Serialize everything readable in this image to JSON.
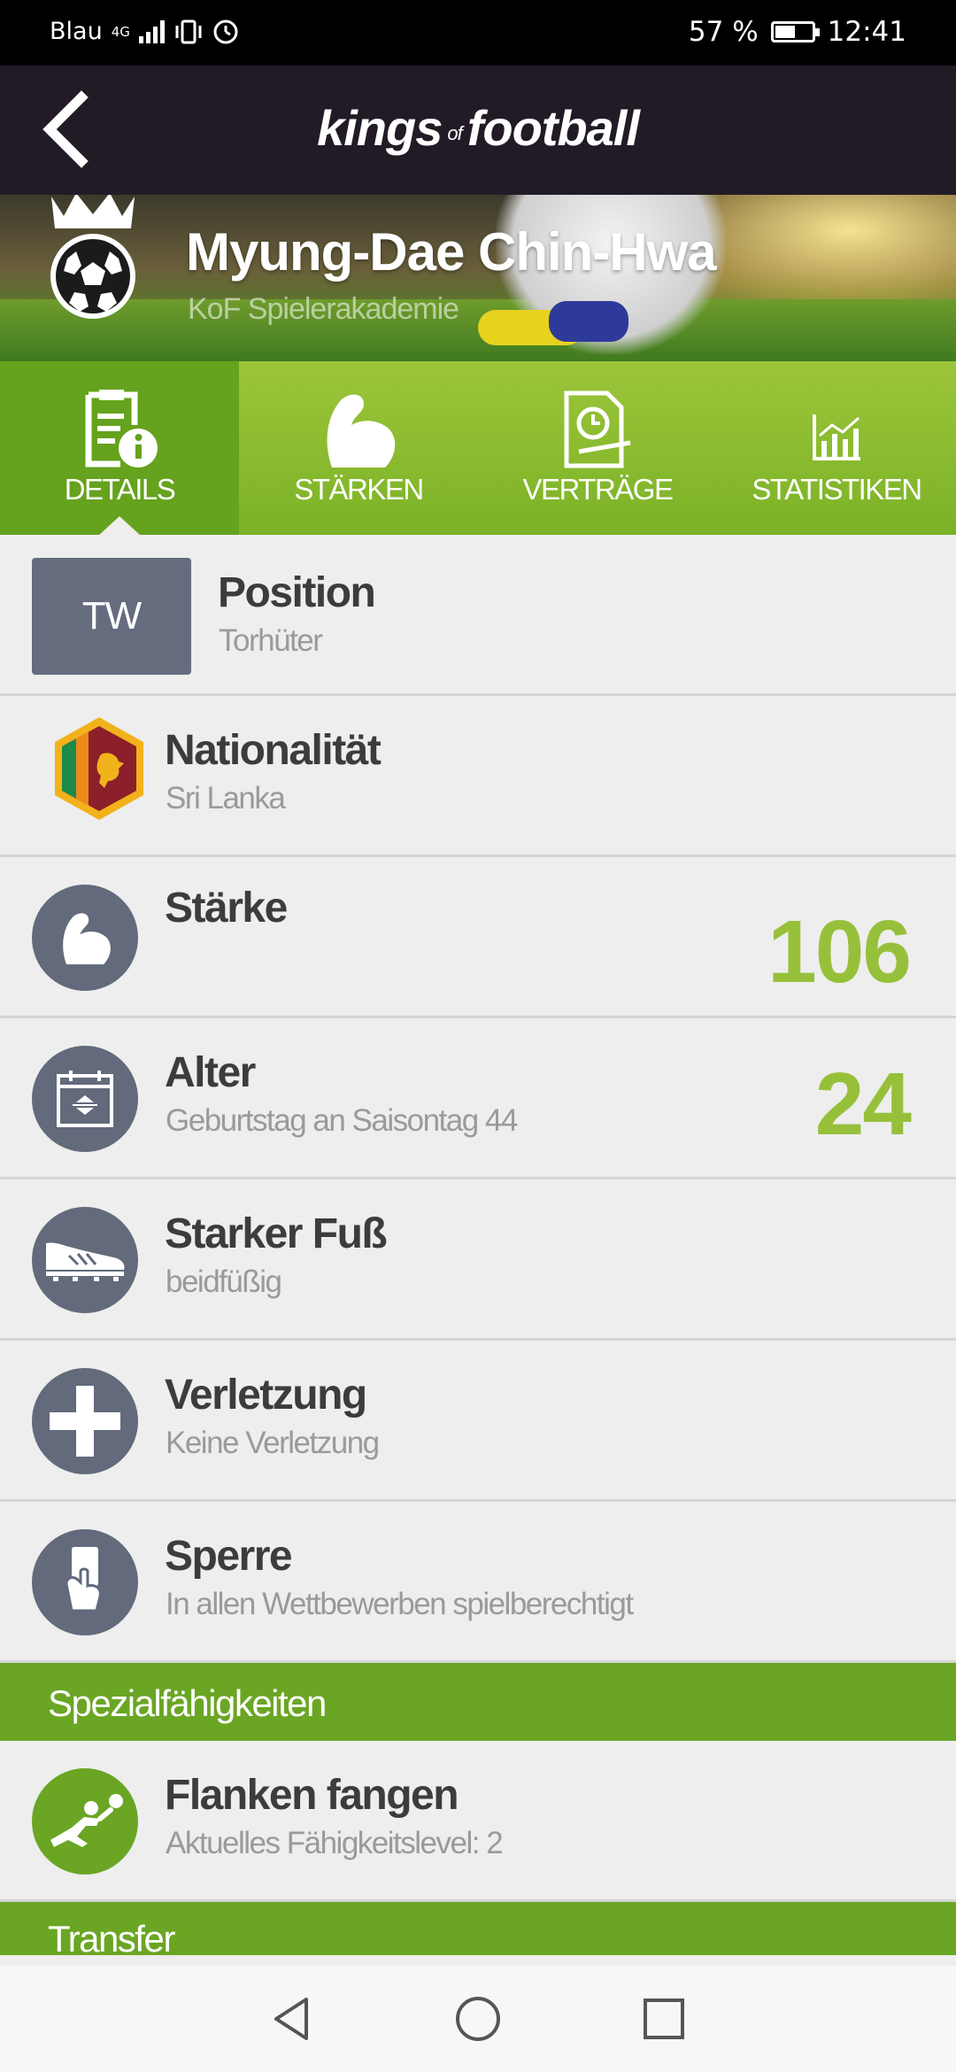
{
  "status_bar": {
    "carrier": "Blau",
    "network": "4G",
    "battery_percent": "57 %",
    "battery_level": 0.57,
    "time": "12:41"
  },
  "app_bar": {
    "logo_left": "kings",
    "logo_of": "of",
    "logo_right": "football",
    "back_icon": "chevron-left-icon"
  },
  "player": {
    "name": "Myung-Dae Chin-Hwa",
    "club": "KoF Spielerakademie"
  },
  "tabs": [
    {
      "label": "DETAILS",
      "icon": "document-info-icon",
      "active": true
    },
    {
      "label": "STÄRKEN",
      "icon": "flexed-arm-icon",
      "active": false
    },
    {
      "label": "VERTRÄGE",
      "icon": "contract-clock-icon",
      "active": false
    },
    {
      "label": "STATISTIKEN",
      "icon": "bar-chart-icon",
      "active": false
    }
  ],
  "details": {
    "position": {
      "badge": "TW",
      "title": "Position",
      "subtitle": "Torhüter"
    },
    "nationality": {
      "title": "Nationalität",
      "subtitle": "Sri Lanka",
      "icon": "sri-lanka-flag-icon"
    },
    "strength": {
      "title": "Stärke",
      "value": "106",
      "icon": "flexed-arm-icon"
    },
    "age": {
      "title": "Alter",
      "subtitle": "Geburtstag an Saisontag 44",
      "value": "24",
      "icon": "calendar-icon"
    },
    "foot": {
      "title": "Starker Fuß",
      "subtitle": "beidfüßig",
      "icon": "football-boot-icon"
    },
    "injury": {
      "title": "Verletzung",
      "subtitle": "Keine Verletzung",
      "icon": "medical-cross-icon"
    },
    "suspension": {
      "title": "Sperre",
      "subtitle": "In allen Wettbewerben spielberechtigt",
      "icon": "card-hand-icon"
    }
  },
  "special_skills": {
    "header": "Spezialfähigkeiten",
    "items": [
      {
        "title": "Flanken fangen",
        "subtitle": "Aktuelles Fähigkeitslevel: 2",
        "icon": "goalkeeper-dive-icon"
      }
    ]
  },
  "transfer": {
    "header": "Transfer"
  },
  "colors": {
    "accent_green": "#6aa624",
    "value_green": "#97c03a",
    "app_bar": "#221b26",
    "icon_circle": "#626a7c"
  }
}
